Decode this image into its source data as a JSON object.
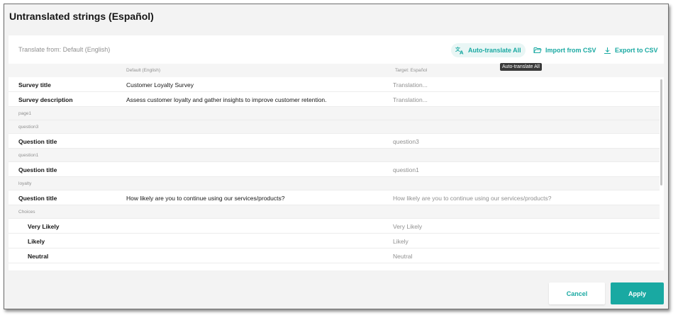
{
  "dialog": {
    "title": "Untranslated strings (Español)"
  },
  "toolbar": {
    "translate_from": "Translate from: Default (English)",
    "auto_translate_label": "Auto-translate All",
    "import_label": "Import from CSV",
    "export_label": "Export to CSV",
    "tooltip": "Auto-translate All"
  },
  "columns": {
    "default": "Default (English)",
    "target": "Target: Español"
  },
  "rows": [
    {
      "kind": "row",
      "name": "Survey title",
      "default": "Customer Loyalty Survey",
      "target": "Translation..."
    },
    {
      "kind": "row",
      "name": "Survey description",
      "default": "Assess customer loyalty and gather insights to improve customer retention.",
      "target": "Translation..."
    },
    {
      "kind": "group",
      "label": "page1"
    },
    {
      "kind": "group",
      "label": "question3"
    },
    {
      "kind": "row",
      "name": "Question title",
      "default": "",
      "target": "question3"
    },
    {
      "kind": "group",
      "label": "question1"
    },
    {
      "kind": "row",
      "name": "Question title",
      "default": "",
      "target": "question1"
    },
    {
      "kind": "group",
      "label": "loyalty"
    },
    {
      "kind": "row",
      "name": "Question title",
      "default": "How likely are you to continue using our services/products?",
      "target": "How likely are you to continue using our services/products?"
    },
    {
      "kind": "group",
      "label": "Choices"
    },
    {
      "kind": "row",
      "indent": true,
      "name": "Very Likely",
      "default": "",
      "target": "Very Likely"
    },
    {
      "kind": "row",
      "indent": true,
      "name": "Likely",
      "default": "",
      "target": "Likely"
    },
    {
      "kind": "row",
      "indent": true,
      "name": "Neutral",
      "default": "",
      "target": "Neutral"
    }
  ],
  "footer": {
    "cancel_label": "Cancel",
    "apply_label": "Apply"
  },
  "colors": {
    "accent": "#19a9a2",
    "background": "#f3f3f3"
  },
  "icons": {
    "auto_translate": "translate-icon",
    "import": "folder-open-icon",
    "export": "download-icon"
  }
}
